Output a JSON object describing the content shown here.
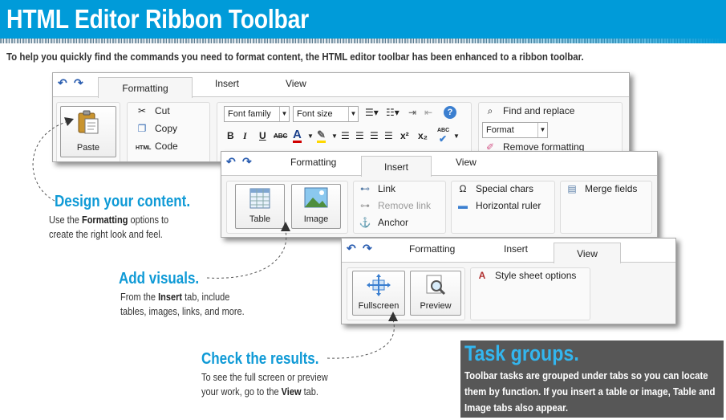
{
  "header": {
    "title": "HTML Editor Ribbon Toolbar",
    "intro": "To help you quickly find the commands you need to format content, the HTML editor toolbar has been enhanced to a ribbon toolbar."
  },
  "colors": {
    "brand": "#009bd9",
    "callout": "#0f9ad6",
    "panel": "#575757",
    "panel_title": "#33b6ef"
  },
  "ribbon1": {
    "tabs": [
      "Formatting",
      "Insert",
      "View"
    ],
    "active_tab": "Formatting",
    "paste": "Paste",
    "clipboard": [
      "Cut",
      "Copy",
      "Code"
    ],
    "code_badge": "HTML",
    "font_family": "Font family",
    "font_size": "Font size",
    "find_replace": "Find and replace",
    "format": "Format",
    "remove_formatting": "Remove formatting",
    "tools": {
      "bold": "B",
      "italic": "I",
      "underline": "U",
      "strike": "ABC",
      "font_color": "A",
      "superscript": "x²",
      "subscript": "x₂",
      "spell": "ABC"
    }
  },
  "ribbon2": {
    "tabs": [
      "Formatting",
      "Insert",
      "View"
    ],
    "active_tab": "Insert",
    "table": "Table",
    "image": "Image",
    "links": [
      "Link",
      "Remove link",
      "Anchor"
    ],
    "special": [
      "Special chars",
      "Horizontal ruler"
    ],
    "merge_fields": "Merge fields",
    "special_char_icon": "Ω"
  },
  "ribbon3": {
    "tabs": [
      "Formatting",
      "Insert",
      "View"
    ],
    "active_tab": "View",
    "fullscreen": "Fullscreen",
    "preview": "Preview",
    "style_sheet": "Style sheet options"
  },
  "callouts": {
    "design_title": "Design your content.",
    "design_l1_pre": "Use the ",
    "design_l1_bold": "Formatting",
    "design_l1_post": " options to",
    "design_l2": "create the right look and feel.",
    "visuals_title": "Add visuals.",
    "visuals_l1_pre": "From the ",
    "visuals_l1_bold": "Insert",
    "visuals_l1_post": " tab, include",
    "visuals_l2": "tables, images, links, and more.",
    "check_title": "Check the results.",
    "check_l1": "To see the full screen or preview",
    "check_l2_pre": "your work, go to the ",
    "check_l2_bold": "View",
    "check_l2_post": " tab."
  },
  "task_groups": {
    "title": "Task groups.",
    "text": "Toolbar tasks are grouped under tabs so you can locate them by function. If you insert a table or image, Table and Image tabs also appear."
  }
}
